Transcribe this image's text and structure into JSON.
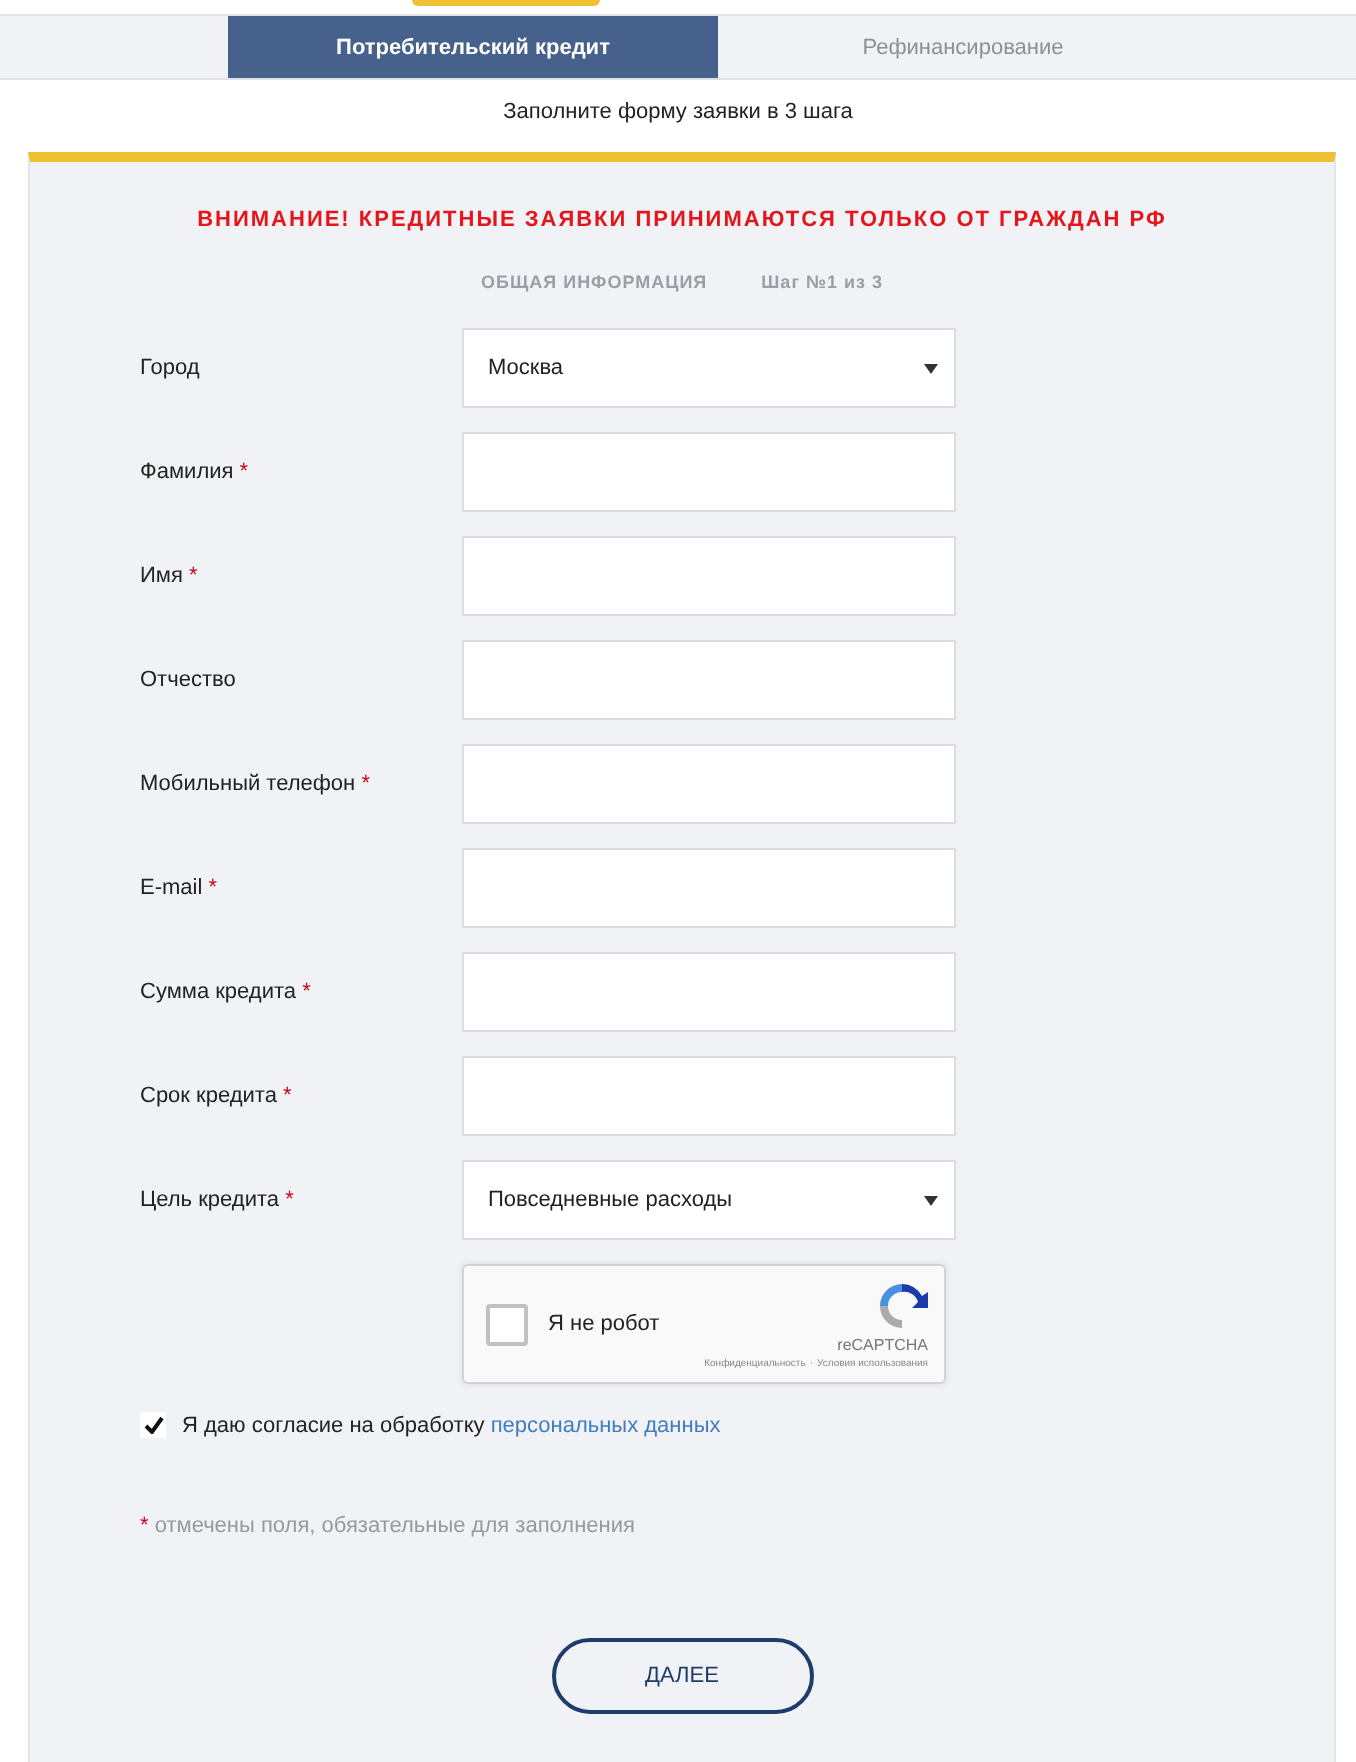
{
  "tabs": [
    {
      "label": "Потребительский кредит",
      "selected": true
    },
    {
      "label": "Рефинансирование",
      "selected": false
    }
  ],
  "subtitle": "Заполните форму заявки в 3 шага",
  "form": {
    "warning": "ВНИМАНИЕ! КРЕДИТНЫЕ ЗАЯВКИ ПРИНИМАЮТСЯ ТОЛЬКО ОТ ГРАЖДАН РФ",
    "section": "ОБЩАЯ ИНФОРМАЦИЯ",
    "step": "Шаг №1 из 3",
    "fields": [
      {
        "label": "Город",
        "required": false,
        "kind": "select",
        "value": "Москва"
      },
      {
        "label": "Фамилия",
        "required": true,
        "kind": "input"
      },
      {
        "label": "Имя",
        "required": true,
        "kind": "input"
      },
      {
        "label": "Отчество",
        "required": false,
        "kind": "input"
      },
      {
        "label": "Мобильный телефон",
        "required": true,
        "kind": "input"
      },
      {
        "label": "E-mail",
        "required": true,
        "kind": "input"
      },
      {
        "label": "Сумма кредита",
        "required": true,
        "kind": "input"
      },
      {
        "label": "Срок кредита",
        "required": true,
        "kind": "input"
      },
      {
        "label": "Цель кредита",
        "required": true,
        "kind": "select",
        "value": "Повседневные расходы"
      }
    ],
    "captcha": {
      "label": "Я не робот",
      "checked": false,
      "brand": "reCAPTCHA",
      "privacy": "Конфиденциальность",
      "separator": "·",
      "terms": "Условия использования"
    },
    "consent": {
      "checked": true,
      "text": "Я даю согласие на обработку",
      "link": "персональных данных"
    },
    "required_mark": "*",
    "required_note": "отмечены поля, обязательные для заполнения",
    "next_button": "ДАЛЕЕ"
  }
}
